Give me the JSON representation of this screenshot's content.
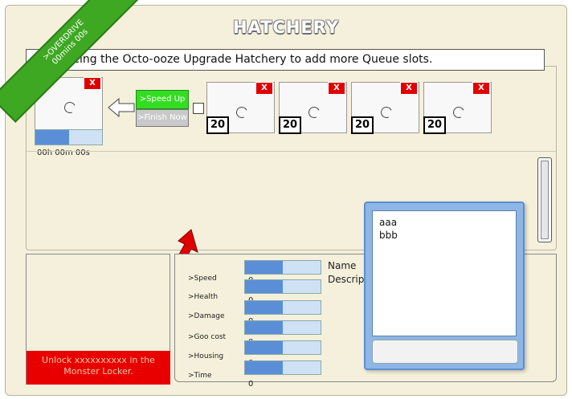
{
  "app": {
    "title": "HATCHERY"
  },
  "ribbon": {
    "line1": ">OVERDRIVE",
    "line2": "00mins 00s"
  },
  "info_bar": {
    "text": "Introducing the Octo-ooze Upgrade Hatchery to add more Queue slots."
  },
  "active_slot": {
    "close_label": "X",
    "timer": "00h 00m 00s",
    "progress": 0.5
  },
  "controls": {
    "speed_up_label": ">Speed Up",
    "finish_now_label": ">Finish Now"
  },
  "queue_slots": [
    {
      "close_label": "X",
      "count": "20"
    },
    {
      "close_label": "X",
      "count": "20"
    },
    {
      "close_label": "X",
      "count": "20"
    },
    {
      "close_label": "X",
      "count": "20"
    }
  ],
  "unlock": {
    "text": "Unlock xxxxxxxxxx in the Monster Locker."
  },
  "stats": [
    {
      "label": ">Speed",
      "value": "0",
      "fill": 0.5
    },
    {
      "label": ">Health",
      "value": "0",
      "fill": 0.5
    },
    {
      "label": ">Damage",
      "value": "0",
      "fill": 0.5
    },
    {
      "label": ">Goo cost",
      "value": "0",
      "fill": 0.5
    },
    {
      "label": ">Housing",
      "value": "0",
      "fill": 0.5
    },
    {
      "label": ">Time",
      "value": "0",
      "fill": 0.5
    }
  ],
  "details": {
    "name_label": "Name",
    "description_label": "Description"
  },
  "popup": {
    "line1": "aaa",
    "line2": "bbb",
    "input_value": ""
  },
  "colors": {
    "accent_green": "#33dd22",
    "close_red": "#e00000",
    "progress_blue": "#5a8fd8",
    "background": "#f4f0db",
    "popup_blue": "#8eb6e6"
  }
}
